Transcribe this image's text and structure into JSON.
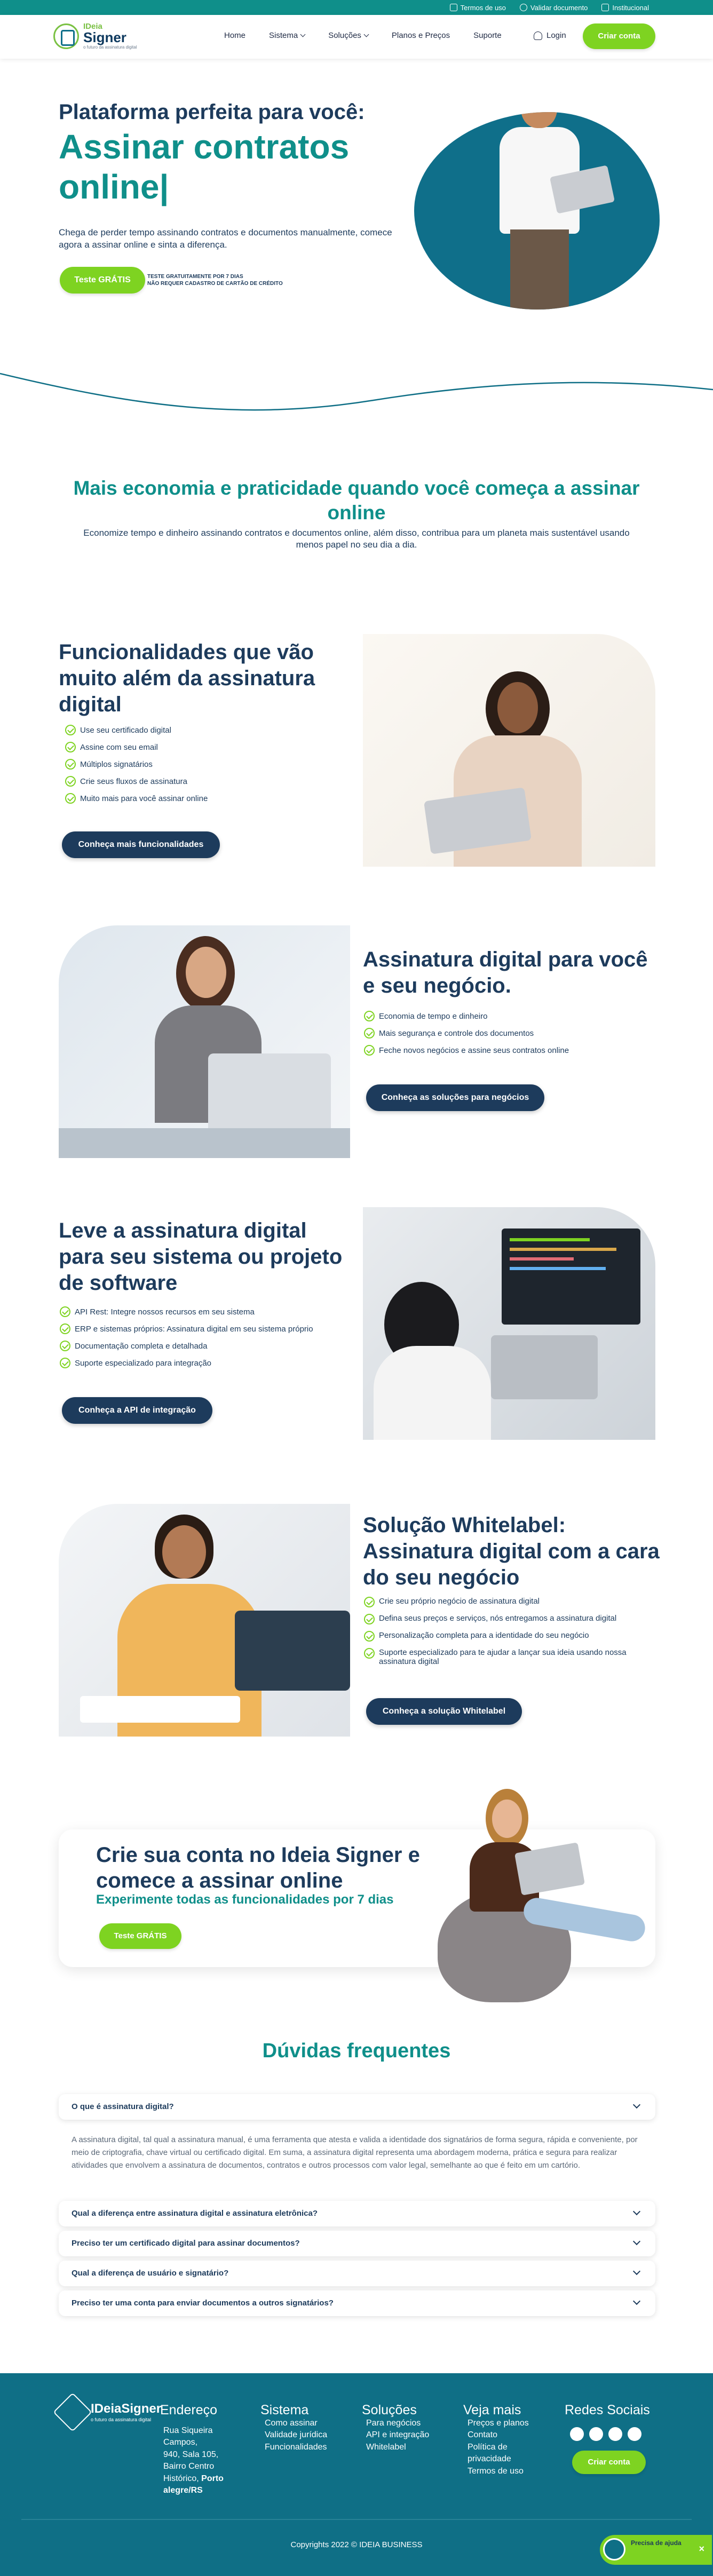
{
  "topbar": {
    "links": [
      "Termos de uso",
      "Validar documento",
      "Institucional"
    ]
  },
  "nav": {
    "logo": {
      "line1": "IDeia",
      "line2": "Signer",
      "tagline": "o futuro da assinatura digital"
    },
    "menu": [
      "Home",
      "Sistema",
      "Soluções",
      "Planos e Preços",
      "Suporte"
    ],
    "login": "Login",
    "cta": "Criar conta"
  },
  "hero": {
    "pre": "Plataforma perfeita para você:",
    "big": "Assinar contratos online|",
    "desc": "Chega de perder tempo assinando contratos e documentos manualmente, comece agora a assinar online e sinta a diferença.",
    "button": "Teste GRÁTIS",
    "note_line1": "TESTE GRATUITAMENTE POR 7 DIAS",
    "note_line2": "NÃO REQUER CADASTRO DE CARTÃO DE CRÉDITO"
  },
  "intro": {
    "title": "Mais economia e praticidade quando você começa a assinar online",
    "subtitle": "Economize tempo e dinheiro assinando contratos e documentos online, além disso, contribua para um planeta mais sustentável usando menos papel no seu dia a dia."
  },
  "features": [
    {
      "title": "Funcionalidades que vão muito além da assinatura digital",
      "items": [
        "Use seu certificado digital",
        "Assine com seu email",
        "Múltiplos signatários",
        "Crie seus fluxos de assinatura",
        "Muito mais para você assinar online"
      ],
      "button": "Conheça mais funcionalidades"
    },
    {
      "title": "Assinatura digital para você e seu negócio.",
      "items": [
        "Economia de tempo e dinheiro",
        "Mais segurança e controle dos documentos",
        "Feche novos negócios e assine seus contratos online"
      ],
      "button": "Conheça as soluções para negócios"
    },
    {
      "title": "Leve a assinatura digital para seu sistema ou projeto de software",
      "items": [
        "API Rest: Integre nossos recursos em seu sistema",
        "ERP e sistemas próprios: Assinatura digital em seu sistema próprio",
        "Documentação completa e detalhada",
        "Suporte especializado para integração"
      ],
      "button": "Conheça a API de integração"
    },
    {
      "title": "Solução Whitelabel: Assinatura digital com a cara do seu negócio",
      "items": [
        "Crie seu próprio negócio de assinatura digital",
        "Defina seus preços e serviços, nós entregamos a assinatura digital",
        "Personalização completa para a identidade do seu negócio",
        "Suporte especializado para te ajudar a lançar sua ideia usando nossa assinatura digital"
      ],
      "button": "Conheça a solução Whitelabel"
    }
  ],
  "cta": {
    "title": "Crie sua conta no Ideia Signer e comece a assinar online",
    "subtitle": "Experimente todas as funcionalidades por 7 dias",
    "button": "Teste GRÁTIS"
  },
  "faq": {
    "title": "Dúvidas frequentes",
    "open_question": "O que é assinatura digital?",
    "open_answer": "A assinatura digital, tal qual a assinatura manual, é uma ferramenta que atesta e valida a identidade dos signatários de forma segura, rápida e conveniente, por meio de criptografia, chave virtual ou certificado digital. Em suma, a assinatura digital representa uma abordagem moderna, prática e segura para realizar atividades que envolvem a assinatura de documentos, contratos e outros processos com valor legal, semelhante ao que é feito em um cartório.",
    "questions": [
      "Qual a diferença entre assinatura digital e assinatura eletrônica?",
      "Preciso ter um certificado digital para assinar documentos?",
      "Qual a diferença de usuário e signatário?",
      "Preciso ter uma conta para enviar documentos a outros signatários?"
    ]
  },
  "footer": {
    "logo": {
      "name": "IDeiaSigner",
      "tagline": "o futuro da assinatura digital"
    },
    "columns": [
      {
        "heading": "Endereço",
        "lines": [
          "Rua Siqueira",
          "Campos,",
          "940, Sala 105,",
          "Bairro Centro",
          "Histórico,"
        ],
        "bold": "Porto alegre/RS"
      },
      {
        "heading": "Sistema",
        "lines": [
          "Como assinar",
          "Validade jurídica",
          "Funcionalidades"
        ]
      },
      {
        "heading": "Soluções",
        "lines": [
          "Para negócios",
          "API e integração",
          "Whitelabel"
        ]
      },
      {
        "heading": "Veja mais",
        "lines": [
          "Preços e planos",
          "Contato",
          "Política de",
          "privacidade",
          "Termos de uso"
        ]
      },
      {
        "heading": "Redes Sociais"
      }
    ],
    "social_icons": [
      "facebook-icon",
      "instagram-icon",
      "linkedin-icon",
      "youtube-icon"
    ],
    "button": "Criar conta",
    "copyright": "Copyrights 2022 © IDEIA BUSINESS"
  },
  "help": {
    "text": "Precisa de ajuda",
    "close": "×"
  },
  "colors": {
    "teal": "#0f8f8a",
    "navy": "#1d3b5c",
    "green": "#7ed321",
    "footer": "#0f6f86"
  }
}
